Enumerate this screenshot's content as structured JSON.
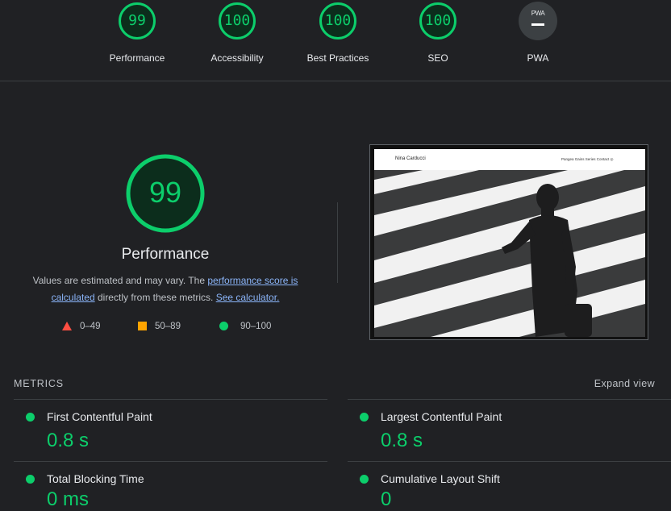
{
  "categories": [
    {
      "label": "Performance",
      "score": "99"
    },
    {
      "label": "Accessibility",
      "score": "100"
    },
    {
      "label": "Best Practices",
      "score": "100"
    },
    {
      "label": "SEO",
      "score": "100"
    },
    {
      "label": "PWA",
      "badge_text": "PWA"
    }
  ],
  "main": {
    "score": "99",
    "title": "Performance",
    "desc_prefix": "Values are estimated and may vary. The ",
    "desc_link1": "performance score is calculated",
    "desc_middle": " directly from these metrics. ",
    "desc_link2": "See calculator.",
    "legend": [
      {
        "range": "0–49",
        "icon": "triangle-icon"
      },
      {
        "range": "50–89",
        "icon": "square-icon"
      },
      {
        "range": "90–100",
        "icon": "circle-icon"
      }
    ]
  },
  "thumbnail": {
    "site_name": "Nina Carducci",
    "nav_links": "Pangea  Gains  Series  Contact"
  },
  "metrics": {
    "heading": "METRICS",
    "expand_label": "Expand view",
    "items": [
      {
        "title": "First Contentful Paint",
        "value": "0.8 s"
      },
      {
        "title": "Largest Contentful Paint",
        "value": "0.8 s"
      },
      {
        "title": "Total Blocking Time",
        "value": "0 ms"
      },
      {
        "title": "Cumulative Layout Shift",
        "value": "0"
      }
    ]
  },
  "colors": {
    "pass": "#0cce6b",
    "average": "#ffa400",
    "fail": "#ff4e42",
    "background": "#202124",
    "link": "#8ab4f8"
  }
}
